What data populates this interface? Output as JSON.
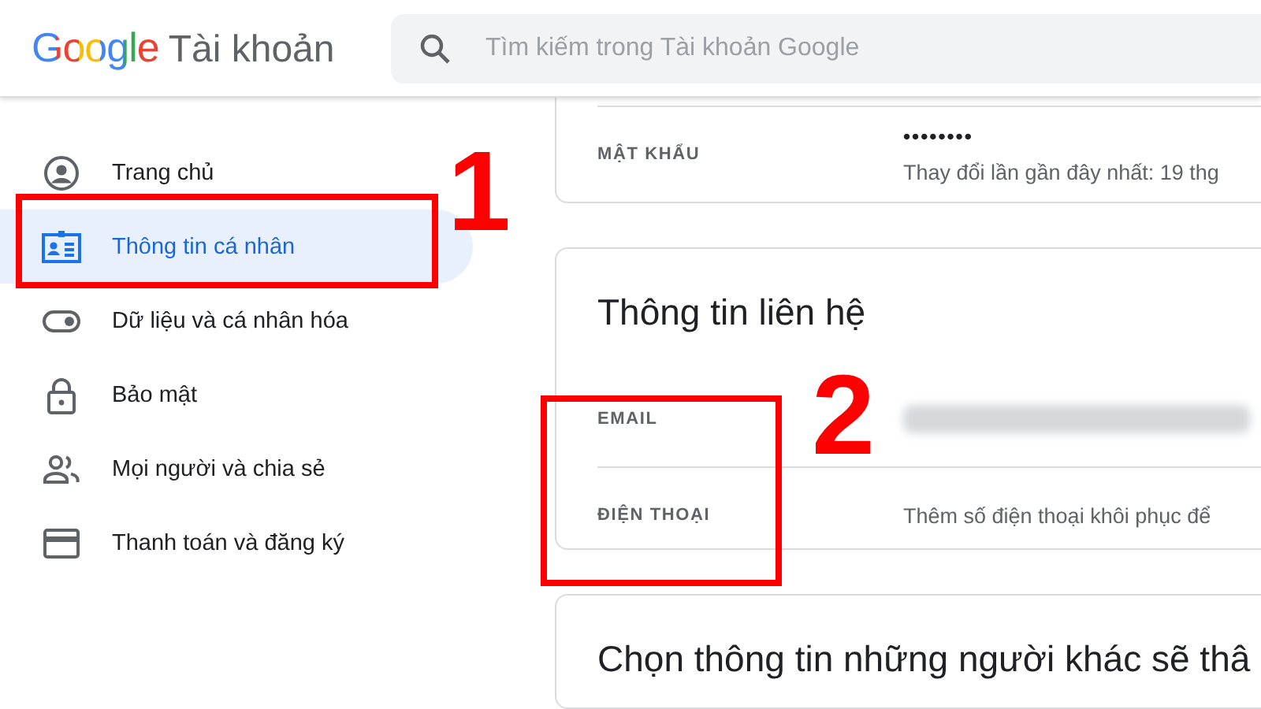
{
  "header": {
    "logo": "Google",
    "product": "Tài khoản",
    "search": {
      "placeholder": "Tìm kiếm trong Tài khoản Google"
    }
  },
  "sidebar": {
    "items": [
      {
        "label": "Trang chủ",
        "kind": "home",
        "selected": false
      },
      {
        "label": "Thông tin cá nhân",
        "kind": "idcard",
        "selected": true
      },
      {
        "label": "Dữ liệu và cá nhân hóa",
        "kind": "toggle",
        "selected": false
      },
      {
        "label": "Bảo mật",
        "kind": "lock",
        "selected": false
      },
      {
        "label": "Mọi người và chia sẻ",
        "kind": "people",
        "selected": false
      },
      {
        "label": "Thanh toán và đăng ký",
        "kind": "card",
        "selected": false
      }
    ]
  },
  "cards": [
    {
      "rows": [
        {
          "label": "MẬT KHẨU",
          "kind": "password",
          "value": "••••••••",
          "note": "Thay đổi lần gần đây nhất: 19 thg"
        }
      ]
    },
    {
      "title": "Thông tin liên hệ",
      "rows": [
        {
          "label": "EMAIL",
          "kind": "blurred"
        },
        {
          "label": "ĐIỆN THOẠI",
          "kind": "note",
          "note": "Thêm số điện thoại khôi phục để"
        }
      ]
    },
    {
      "title": "Chọn thông tin những người khác sẽ thâ"
    }
  ],
  "annotations": [
    {
      "label": "1"
    },
    {
      "label": "2"
    }
  ]
}
